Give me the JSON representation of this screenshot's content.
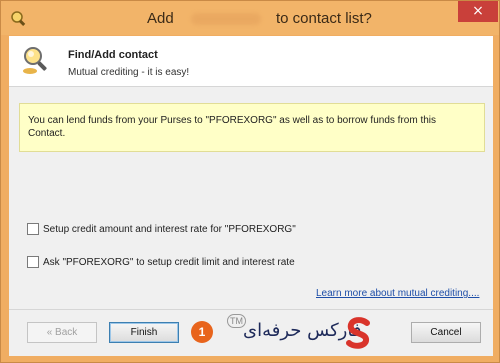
{
  "window": {
    "title_prefix": "Add",
    "title_suffix": "to contact list?",
    "close_glyph": "×"
  },
  "header": {
    "title": "Find/Add contact",
    "subtitle": "Mutual crediting - it is easy!"
  },
  "info": {
    "text": "You can lend funds from your Purses to  \"PFOREXORG\" as well as to borrow funds from this Contact."
  },
  "options": [
    {
      "label": "Setup credit amount and interest rate for  \"PFOREXORG\"",
      "checked": false
    },
    {
      "label": "Ask \"PFOREXORG\" to setup credit limit and interest rate",
      "checked": false
    }
  ],
  "learn_more": "Learn more about mutual crediting....",
  "buttons": {
    "back": "« Back",
    "finish": "Finish",
    "cancel": "Cancel"
  },
  "step_badge": "1",
  "watermark": {
    "text": "فارکس حرفه‌ای",
    "tm": "TM"
  },
  "colors": {
    "titlebar": "#f2b469",
    "close": "#c9403a",
    "info_bg": "#ffffc7",
    "link": "#1e4ea8",
    "badge": "#e8641c"
  }
}
